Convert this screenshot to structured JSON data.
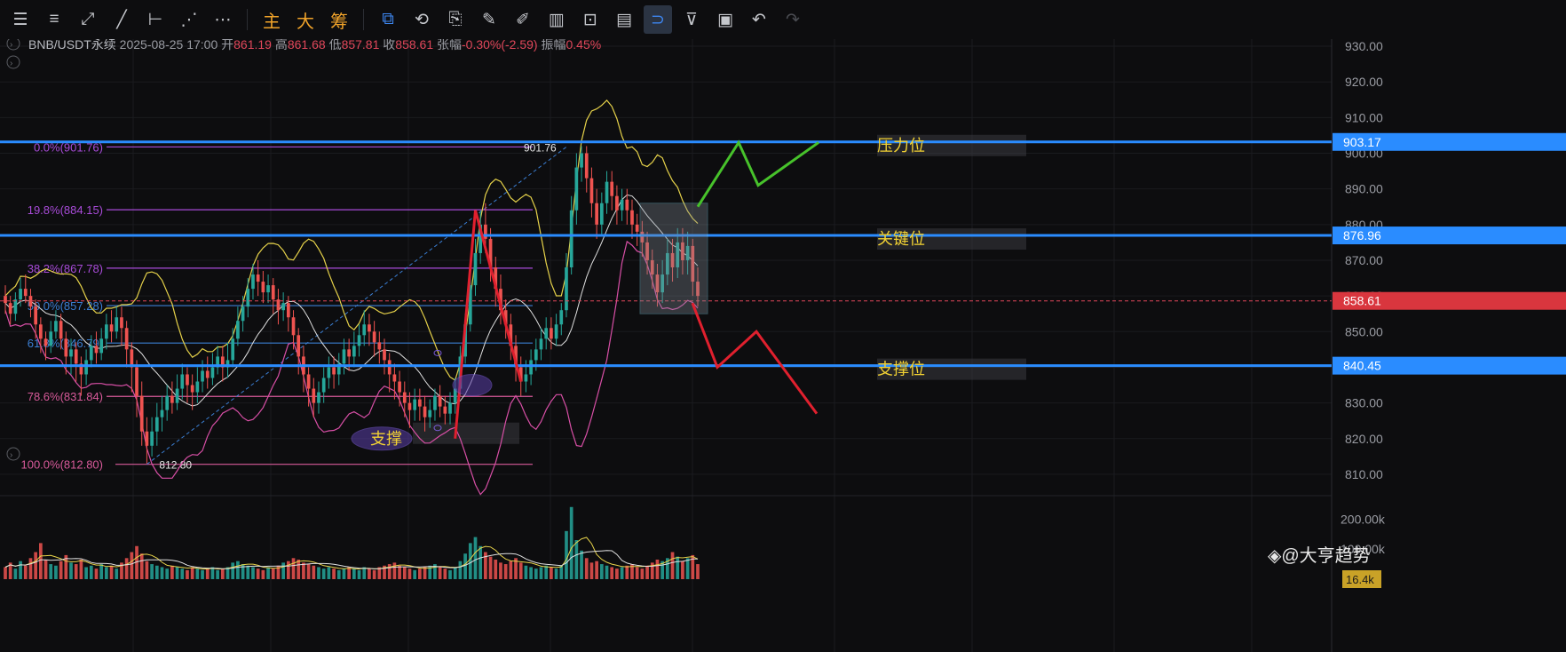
{
  "toolbar": {
    "left_icons": [
      "menu-icon",
      "list-icon",
      "trend-line-icon",
      "ray-icon",
      "horizontal-line-icon",
      "fib-icon",
      "more-icon"
    ],
    "labels": [
      "主",
      "大",
      "筹"
    ],
    "right_icons": [
      "indicator-icon",
      "replay-icon",
      "copy-icon",
      "ruler-icon",
      "pen-icon",
      "candle-type-icon",
      "lock-icon",
      "note-icon",
      "magnet-icon",
      "filter-icon",
      "trash-icon",
      "undo-icon",
      "redo-icon"
    ]
  },
  "header": {
    "symbol": "BNB/USDT永续",
    "datetime": "2025-08-25 17:00",
    "open_label": "开",
    "open": "861.19",
    "high_label": "高",
    "high": "861.68",
    "low_label": "低",
    "low": "857.81",
    "close_label": "收",
    "close": "858.61",
    "change_label": "张幅",
    "change": "-0.30%(-2.59)",
    "amp_label": "振幅",
    "amp": "0.45%"
  },
  "watermark": "@大亨趋势",
  "colors": {
    "up": "#26a69a",
    "down": "#ef5350",
    "bb_upper": "#e6d24a",
    "bb_mid": "#e0e0e0",
    "bb_lower": "#d84fa6",
    "level": "#2a8cff",
    "fib_a": "#a84bd8",
    "fib_b": "#3b7fd4",
    "fib_c": "#d85a9a",
    "green_path": "#47c22b",
    "red_path": "#e0202e",
    "zone_label": "#f2d233"
  },
  "chart_data": {
    "type": "candlestick",
    "price_axis": {
      "min": 805,
      "max": 932,
      "ticks": [
        930,
        920,
        910,
        900,
        890,
        880,
        870,
        860,
        850,
        840,
        830,
        820,
        810
      ],
      "tick_labels": [
        "930.00",
        "920.00",
        "910.00",
        "900.00",
        "890.00",
        "880.00",
        "870.00",
        "860.00",
        "850.00",
        "840.00",
        "830.00",
        "820.00",
        "810.00"
      ]
    },
    "volume_axis": {
      "ticks": [
        200000,
        100000
      ],
      "tick_labels": [
        "200.00k",
        "100.00k"
      ],
      "max": 260000
    },
    "current_price": {
      "value": 858.61,
      "label": "858.61"
    },
    "current_volume_label": "16.4k",
    "key_levels": [
      {
        "name": "压力位",
        "value": 903.17,
        "label": "903.17"
      },
      {
        "name": "关键位",
        "value": 876.96,
        "label": "876.96"
      },
      {
        "name": "支撑位",
        "value": 840.45,
        "label": "840.45"
      }
    ],
    "fibonacci": [
      {
        "label": "0.0%(901.76)",
        "value": 901.76
      },
      {
        "label": "19.8%(884.15)",
        "value": 884.15
      },
      {
        "label": "38.2%(867.78)",
        "value": 867.78
      },
      {
        "label": "50.0%(857.28)",
        "value": 857.28
      },
      {
        "label": "61.8%(846.79)",
        "value": 846.79
      },
      {
        "label": "78.6%(831.84)",
        "value": 831.84
      },
      {
        "label": "100.0%(812.80)",
        "value": 812.8
      }
    ],
    "swing_high": {
      "label": "901.76",
      "value": 901.76
    },
    "swing_low": {
      "label": "812.80",
      "value": 812.8
    },
    "support_annotation": "支撑",
    "candles": [
      [
        860,
        858,
        863,
        855
      ],
      [
        858,
        855,
        860,
        852
      ],
      [
        855,
        859,
        861,
        853
      ],
      [
        859,
        862,
        865,
        857
      ],
      [
        862,
        860,
        866,
        858
      ],
      [
        860,
        857,
        862,
        854
      ],
      [
        857,
        852,
        859,
        848
      ],
      [
        852,
        848,
        854,
        844
      ],
      [
        848,
        846,
        850,
        842
      ],
      [
        846,
        850,
        853,
        844
      ],
      [
        850,
        853,
        856,
        848
      ],
      [
        853,
        848,
        855,
        845
      ],
      [
        848,
        843,
        850,
        838
      ],
      [
        843,
        845,
        848,
        838
      ],
      [
        845,
        841,
        847,
        836
      ],
      [
        841,
        838,
        843,
        832
      ],
      [
        838,
        842,
        845,
        835
      ],
      [
        842,
        846,
        849,
        840
      ],
      [
        846,
        844,
        850,
        841
      ],
      [
        844,
        848,
        851,
        842
      ],
      [
        848,
        852,
        855,
        845
      ],
      [
        852,
        850,
        856,
        847
      ],
      [
        850,
        854,
        857,
        848
      ],
      [
        854,
        851,
        857,
        846
      ],
      [
        851,
        845,
        853,
        840
      ],
      [
        845,
        840,
        847,
        833
      ],
      [
        840,
        832,
        842,
        826
      ],
      [
        832,
        822,
        836,
        818
      ],
      [
        822,
        818,
        826,
        813
      ],
      [
        818,
        822,
        826,
        815
      ],
      [
        822,
        826,
        830,
        818
      ],
      [
        826,
        828,
        832,
        822
      ],
      [
        828,
        832,
        835,
        825
      ],
      [
        832,
        830,
        836,
        827
      ],
      [
        830,
        834,
        838,
        828
      ],
      [
        834,
        838,
        841,
        831
      ],
      [
        838,
        835,
        840,
        830
      ],
      [
        835,
        833,
        838,
        828
      ],
      [
        833,
        836,
        840,
        830
      ],
      [
        836,
        839,
        842,
        833
      ],
      [
        839,
        837,
        843,
        834
      ],
      [
        837,
        840,
        844,
        835
      ],
      [
        840,
        843,
        846,
        838
      ],
      [
        843,
        840,
        846,
        836
      ],
      [
        840,
        842,
        847,
        837
      ],
      [
        842,
        848,
        851,
        840
      ],
      [
        848,
        853,
        857,
        846
      ],
      [
        853,
        857,
        860,
        850
      ],
      [
        857,
        862,
        865,
        854
      ],
      [
        862,
        866,
        869,
        859
      ],
      [
        866,
        864,
        870,
        860
      ],
      [
        864,
        861,
        867,
        858
      ],
      [
        861,
        863,
        866,
        858
      ],
      [
        863,
        859,
        865,
        855
      ],
      [
        859,
        856,
        862,
        852
      ],
      [
        856,
        858,
        861,
        853
      ],
      [
        858,
        854,
        860,
        850
      ],
      [
        854,
        849,
        856,
        845
      ],
      [
        849,
        843,
        851,
        838
      ],
      [
        843,
        838,
        846,
        833
      ],
      [
        838,
        834,
        840,
        829
      ],
      [
        834,
        830,
        837,
        826
      ],
      [
        830,
        833,
        836,
        827
      ],
      [
        833,
        837,
        840,
        830
      ],
      [
        837,
        840,
        843,
        834
      ],
      [
        840,
        838,
        843,
        834
      ],
      [
        838,
        841,
        844,
        835
      ],
      [
        841,
        845,
        848,
        838
      ],
      [
        845,
        843,
        848,
        839
      ],
      [
        843,
        846,
        850,
        840
      ],
      [
        846,
        849,
        852,
        843
      ],
      [
        849,
        852,
        856,
        846
      ],
      [
        852,
        850,
        855,
        846
      ],
      [
        850,
        847,
        853,
        843
      ],
      [
        847,
        845,
        850,
        841
      ],
      [
        845,
        842,
        848,
        838
      ],
      [
        842,
        838,
        844,
        833
      ],
      [
        838,
        836,
        841,
        831
      ],
      [
        836,
        833,
        839,
        829
      ],
      [
        833,
        830,
        836,
        826
      ],
      [
        830,
        828,
        833,
        823
      ],
      [
        828,
        831,
        834,
        825
      ],
      [
        831,
        829,
        834,
        825
      ],
      [
        829,
        826,
        832,
        822
      ],
      [
        826,
        828,
        831,
        823
      ],
      [
        828,
        832,
        834,
        825
      ],
      [
        832,
        829,
        835,
        826
      ],
      [
        829,
        827,
        832,
        824
      ],
      [
        827,
        830,
        833,
        824
      ],
      [
        830,
        834,
        837,
        827
      ],
      [
        834,
        843,
        846,
        832
      ],
      [
        843,
        852,
        855,
        841
      ],
      [
        852,
        863,
        866,
        850
      ],
      [
        863,
        872,
        876,
        860
      ],
      [
        872,
        880,
        884,
        869
      ],
      [
        880,
        876,
        886,
        872
      ],
      [
        876,
        868,
        879,
        864
      ],
      [
        868,
        862,
        871,
        857
      ],
      [
        862,
        856,
        866,
        852
      ],
      [
        856,
        852,
        859,
        848
      ],
      [
        852,
        846,
        855,
        842
      ],
      [
        846,
        840,
        849,
        836
      ],
      [
        840,
        836,
        843,
        832
      ],
      [
        836,
        838,
        842,
        833
      ],
      [
        838,
        842,
        845,
        835
      ],
      [
        842,
        845,
        848,
        839
      ],
      [
        845,
        848,
        851,
        842
      ],
      [
        848,
        851,
        854,
        845
      ],
      [
        851,
        848,
        854,
        845
      ],
      [
        848,
        852,
        855,
        846
      ],
      [
        852,
        856,
        858,
        849
      ],
      [
        856,
        868,
        872,
        854
      ],
      [
        868,
        884,
        888,
        866
      ],
      [
        884,
        896,
        900,
        880
      ],
      [
        896,
        900,
        902,
        892
      ],
      [
        900,
        893,
        902,
        889
      ],
      [
        893,
        886,
        896,
        882
      ],
      [
        886,
        880,
        890,
        876
      ],
      [
        880,
        886,
        889,
        877
      ],
      [
        886,
        892,
        895,
        883
      ],
      [
        892,
        888,
        895,
        884
      ],
      [
        888,
        884,
        891,
        880
      ],
      [
        884,
        887,
        890,
        881
      ],
      [
        887,
        884,
        890,
        880
      ],
      [
        884,
        880,
        887,
        876
      ],
      [
        880,
        878,
        883,
        874
      ],
      [
        878,
        875,
        881,
        871
      ],
      [
        875,
        870,
        878,
        866
      ],
      [
        870,
        866,
        873,
        862
      ],
      [
        866,
        861,
        869,
        857
      ],
      [
        861,
        866,
        870,
        858
      ],
      [
        866,
        872,
        876,
        863
      ],
      [
        872,
        868,
        876,
        864
      ],
      [
        868,
        875,
        879,
        865
      ],
      [
        875,
        870,
        879,
        866
      ],
      [
        870,
        874,
        878,
        866
      ],
      [
        874,
        864,
        876,
        860
      ],
      [
        864,
        860,
        868,
        857
      ]
    ],
    "volumes": [
      40,
      55,
      35,
      60,
      45,
      70,
      90,
      120,
      65,
      50,
      45,
      60,
      80,
      55,
      50,
      65,
      40,
      45,
      35,
      50,
      40,
      45,
      35,
      55,
      70,
      90,
      110,
      85,
      60,
      50,
      45,
      40,
      35,
      45,
      40,
      35,
      30,
      40,
      35,
      30,
      35,
      40,
      30,
      35,
      40,
      55,
      60,
      50,
      45,
      40,
      35,
      30,
      40,
      35,
      45,
      55,
      60,
      70,
      65,
      55,
      50,
      45,
      40,
      35,
      40,
      35,
      30,
      35,
      40,
      35,
      30,
      40,
      35,
      30,
      40,
      45,
      50,
      55,
      45,
      40,
      35,
      30,
      35,
      40,
      45,
      50,
      40,
      35,
      30,
      40,
      60,
      85,
      120,
      140,
      110,
      90,
      75,
      65,
      55,
      50,
      60,
      70,
      55,
      45,
      40,
      35,
      40,
      45,
      40,
      35,
      45,
      160,
      240,
      130,
      95,
      70,
      55,
      60,
      50,
      45,
      40,
      35,
      40,
      45,
      50,
      40,
      35,
      45,
      55,
      65,
      60,
      70,
      90,
      75,
      60,
      70,
      80,
      50
    ]
  }
}
